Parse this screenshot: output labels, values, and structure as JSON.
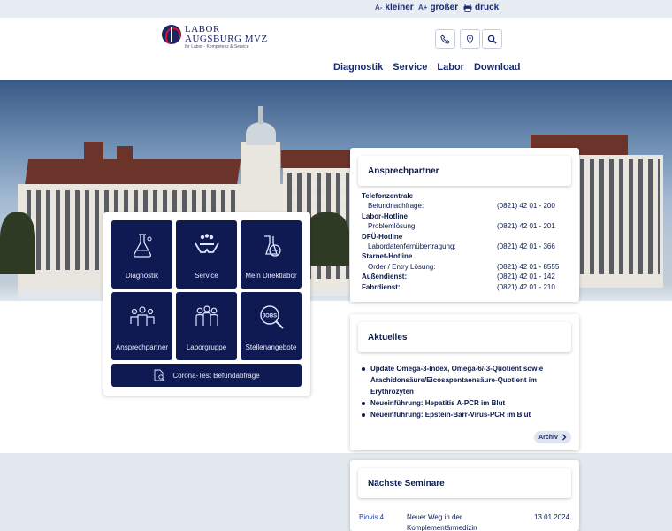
{
  "topbar": {
    "smaller": {
      "glyph": "A-",
      "label": "kleiner"
    },
    "bigger": {
      "glyph": "A+",
      "label": "größer"
    },
    "print": {
      "label": "druck"
    }
  },
  "logo": {
    "line1": "LABOR",
    "line2": "AUGSBURG MVZ",
    "tagline": "Ihr Labor - Kompetenz & Service"
  },
  "nav": {
    "items": [
      "Diagnostik",
      "Service",
      "Labor",
      "Download"
    ]
  },
  "tiles": {
    "items": [
      {
        "label": "Diagnostik",
        "icon": "flask-icon"
      },
      {
        "label": "Service",
        "icon": "hands-people-icon"
      },
      {
        "label": "Mein Direktlabor",
        "icon": "lab-glass-icon"
      },
      {
        "label": "Ansprechpartner",
        "icon": "people-icon"
      },
      {
        "label": "Laborgruppe",
        "icon": "group-icon"
      },
      {
        "label": "Stellenangebote",
        "icon": "jobs-search-icon"
      }
    ],
    "wide": {
      "label": "Corona-Test Befundabfrage",
      "icon": "document-search-icon"
    }
  },
  "contact": {
    "title": "Ansprechpartner",
    "rows": [
      {
        "label": "Telefonzentrale",
        "value": "",
        "style": "bold"
      },
      {
        "label": "Befundnachfrage:",
        "value": "(0821) 42 01 - 200",
        "style": "indent"
      },
      {
        "label": "Labor-Hotline",
        "value": "",
        "style": "bold"
      },
      {
        "label": "Problemlösung:",
        "value": "(0821) 42 01 - 201",
        "style": "indent"
      },
      {
        "label": "DFÜ-Hotline",
        "value": "",
        "style": "bold"
      },
      {
        "label": "Labordatenfernübertragung:",
        "value": "(0821) 42 01 - 366",
        "style": "indent"
      },
      {
        "label": "Starnet-Hotline",
        "value": "",
        "style": "bold"
      },
      {
        "label": "Order / Entry Lösung:",
        "value": "(0821) 42 01 - 8555",
        "style": "indent"
      },
      {
        "label": "Außendienst:",
        "value": "(0821) 42 01 - 142",
        "style": "bold"
      },
      {
        "label": "Fahrdienst:",
        "value": "(0821) 42 01 - 210",
        "style": "bold"
      }
    ]
  },
  "news": {
    "title": "Aktuelles",
    "items": [
      "Update Omega-3-Index, Omega-6/-3-Quotient sowie Arachidonsäure/Eicosapentaensäure-Quotient im Erythrozyten",
      "Neueinführung: Hepatitis A-PCR im Blut",
      "Neueinführung: Epstein-Barr-Virus-PCR im Blut"
    ],
    "archive_label": "Archiv"
  },
  "seminars": {
    "title": "Nächste Seminare",
    "items": [
      {
        "location": "Biovis 4",
        "title": "Neuer Weg in der Komplementärmedizin",
        "date": "13.01.2024"
      }
    ]
  }
}
